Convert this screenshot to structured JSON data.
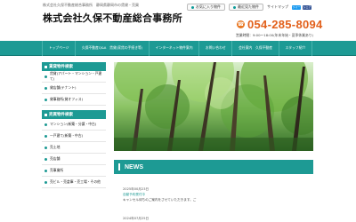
{
  "header": {
    "topline": "株式会社久保不動産総合事務所　静岡県静岡市の賃貸・売買",
    "logo": "株式会社久保不動産総合事務所",
    "links": [
      "お気に入り物件",
      "最近見た物件"
    ],
    "sitemap": "サイトマップ",
    "social": [
      "ツイート",
      "シェア"
    ],
    "phone": "054-285-8094",
    "hours": "営業時間：9:00～18:00(年末年始・夏季休業あり)"
  },
  "nav": {
    "items": [
      "トップページ",
      "久保不動産Q&A　賃貸(家賃の手続き等)",
      "インターネット物件案内",
      "お問い合わせ",
      "会社案内　久保不動産",
      "スタッフ紹介"
    ]
  },
  "sidebar": {
    "rent_heading": "賃貸物件検索",
    "rent_items": [
      "賃貸(アパート・マンション・戸建て)",
      "貸店舗(テナント)",
      "貸事務所(貸オフィス)"
    ],
    "sale_heading": "売買物件検索",
    "sale_items": [
      "マンション(新築・分譲・中古)",
      "一戸建て(新築・中古)",
      "売土地",
      "売店舗",
      "売事業所",
      "売ビル・売倉庫・売工場・その他"
    ]
  },
  "main": {
    "news_title": "NEWS",
    "news": [
      {
        "date": "2025年00月23日",
        "title": "自動予約受付中",
        "text": "キャンセル待ちのご案内をさせていただきます。ご"
      },
      {
        "date": "2024年07月25日",
        "title": "",
        "text": ""
      }
    ]
  }
}
